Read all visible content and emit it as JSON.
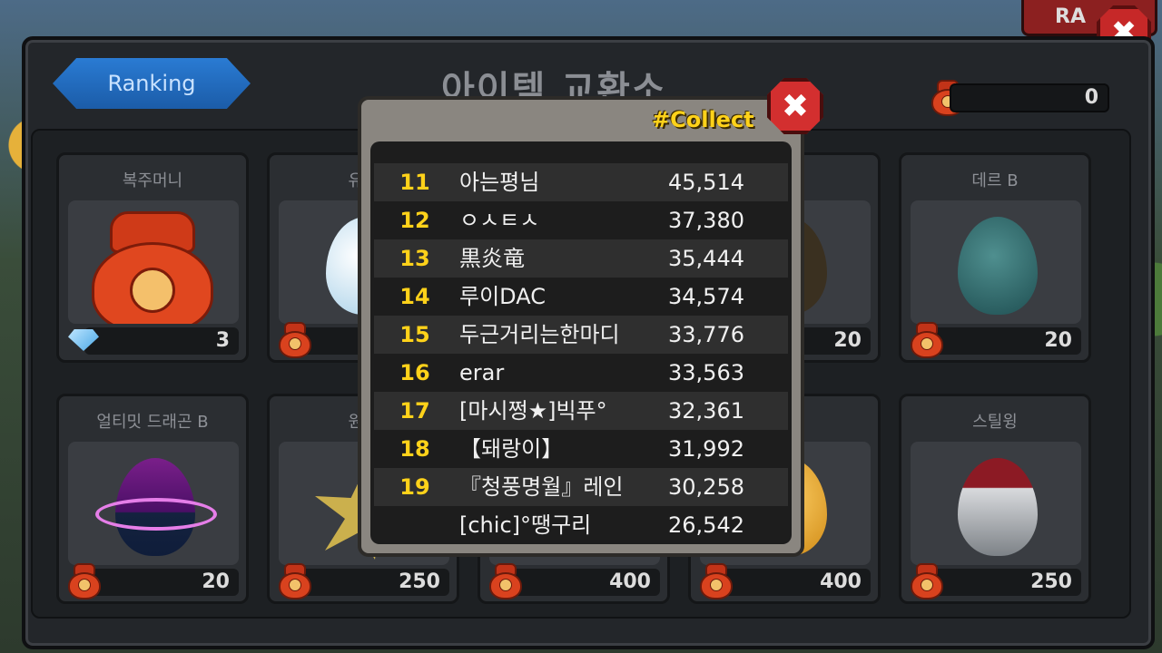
{
  "background": {
    "rank_tab_label": "RA"
  },
  "shop": {
    "ranking_button": "Ranking",
    "title": "아이템 교환소",
    "currency_value": "0"
  },
  "items": [
    {
      "name": "복주머니",
      "price": "3",
      "currency": "diamond"
    },
    {
      "name": "유리",
      "price": "",
      "currency": "bag"
    },
    {
      "name": "",
      "price": "20",
      "currency": "bag"
    },
    {
      "name": "데르 B",
      "price": "20",
      "currency": "bag"
    },
    {
      "name": "얼티밋 드래곤 B",
      "price": "20",
      "currency": "bag"
    },
    {
      "name": "원더",
      "price": "250",
      "currency": "bag"
    },
    {
      "name": "",
      "price": "400",
      "currency": "bag"
    },
    {
      "name": "",
      "price": "400",
      "currency": "bag"
    },
    {
      "name": "스틸윙",
      "price": "250",
      "currency": "bag"
    }
  ],
  "popup": {
    "tag": "#Collect",
    "rows": [
      {
        "rank": "11",
        "name": "아는평님",
        "score": "45,514"
      },
      {
        "rank": "12",
        "name": "ㅇㅅㅌㅅ",
        "score": "37,380"
      },
      {
        "rank": "13",
        "name": "黒炎竜",
        "score": "35,444"
      },
      {
        "rank": "14",
        "name": "루이DAC",
        "score": "34,574"
      },
      {
        "rank": "15",
        "name": "두근거리는한마디",
        "score": "33,776"
      },
      {
        "rank": "16",
        "name": "erar",
        "score": "33,563"
      },
      {
        "rank": "17",
        "name": "[마시쩡★]빅푸°",
        "score": "32,361"
      },
      {
        "rank": "18",
        "name": "【돼랑이】",
        "score": "31,992"
      },
      {
        "rank": "19",
        "name": "『청풍명월』레인",
        "score": "30,258"
      },
      {
        "rank": "",
        "name": "[chic]°땡구리",
        "score": "26,542"
      }
    ]
  },
  "colors": {
    "rank_number": "#ffd21a",
    "close_button": "#d32f2f",
    "ranking_button": "#1b5ca8"
  }
}
